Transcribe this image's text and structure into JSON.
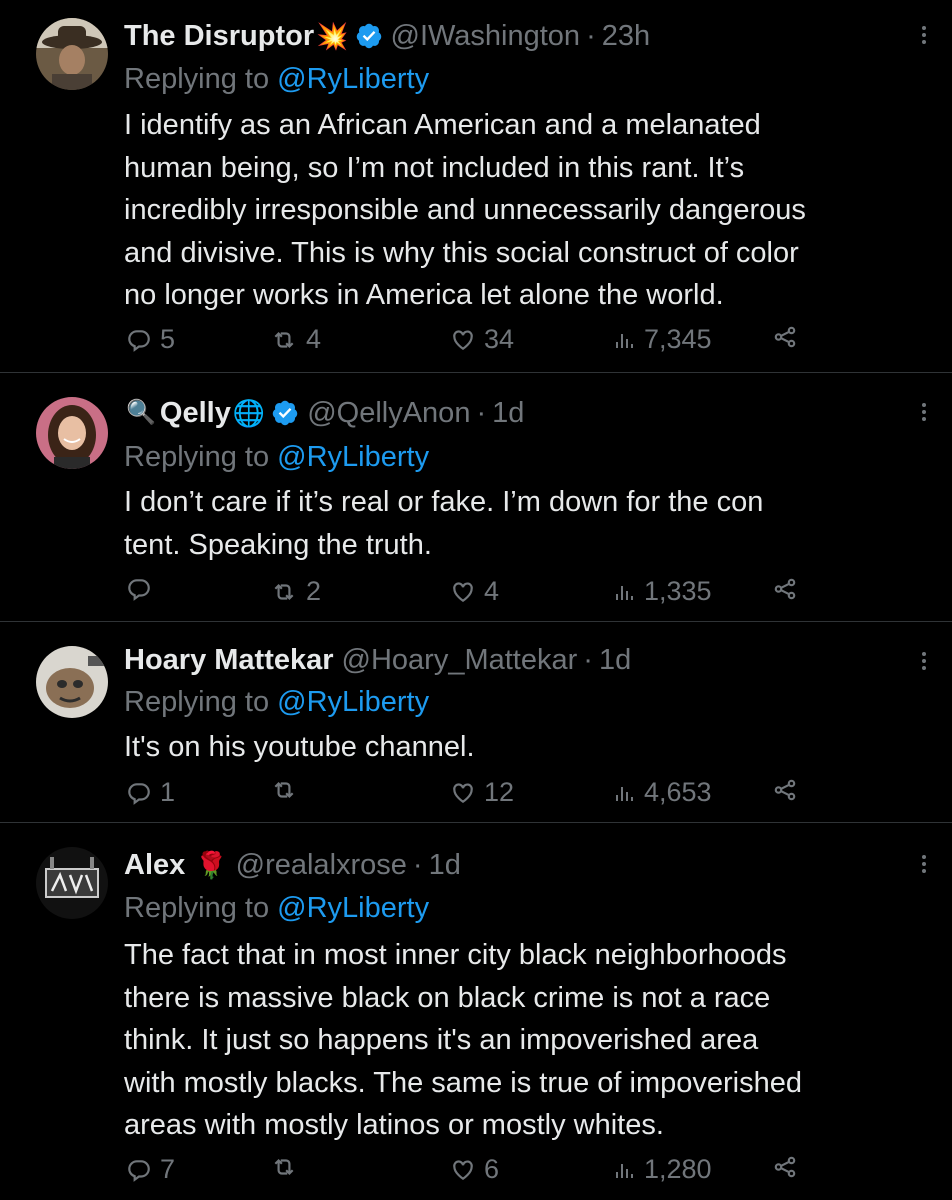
{
  "tweets": [
    {
      "name": "The Disruptor",
      "name_emoji": "💥",
      "verified": true,
      "handle": "@IWashington",
      "time": "23h",
      "replying_prefix": "Replying to",
      "replying_to": "@RyLiberty",
      "text": "I identify as an African American and a melanated\nhuman being, so I’m not included in this rant. It’s\nincredibly irresponsible and unnecessarily dangerous\nand divisive. This is why this social construct of color\nno longer works in America let alone the world.",
      "replies": "5",
      "retweets": "4",
      "likes": "34",
      "views": "7,345",
      "avatar_icon": "cowboy-hat-avatar"
    },
    {
      "name_prefix_emoji": "🔍",
      "name": "Qelly",
      "name_emoji": "🌐",
      "verified": true,
      "handle": "@QellyAnon",
      "time": "1d",
      "replying_prefix": "Replying to",
      "replying_to": "@RyLiberty",
      "text": "I don’t care if it’s real or fake. I’m down for the con\ntent. Speaking the truth.",
      "replies": "",
      "retweets": "2",
      "likes": "4",
      "views": "1,335",
      "avatar_icon": "woman-portrait-avatar"
    },
    {
      "name": "Hoary Mattekar",
      "verified": false,
      "handle": "@Hoary_Mattekar",
      "time": "1d",
      "replying_prefix": "Replying to",
      "replying_to": "@RyLiberty",
      "text": "It's on his youtube channel.",
      "replies": "1",
      "retweets": "",
      "likes": "12",
      "views": "4,653",
      "avatar_icon": "creature-avatar"
    },
    {
      "name": "Alex",
      "name_emoji": "🌹",
      "verified": false,
      "handle": "@realalxrose",
      "time": "1d",
      "replying_prefix": "Replying to",
      "replying_to": "@RyLiberty",
      "text": "The fact that in most inner city black neighborhoods\nthere is massive black on black crime is not a race\nthink. It just so happens it's an impoverished area\nwith mostly blacks. The same is true of impoverished\nareas with mostly latinos or mostly whites.",
      "replies": "7",
      "retweets": "",
      "likes": "6",
      "views": "1,280",
      "avatar_icon": "graffiti-avatar"
    }
  ],
  "colors": {
    "background": "#000000",
    "text": "#e7e9ea",
    "muted": "#71767b",
    "link": "#1d9bf0",
    "divider": "#2f3336"
  }
}
